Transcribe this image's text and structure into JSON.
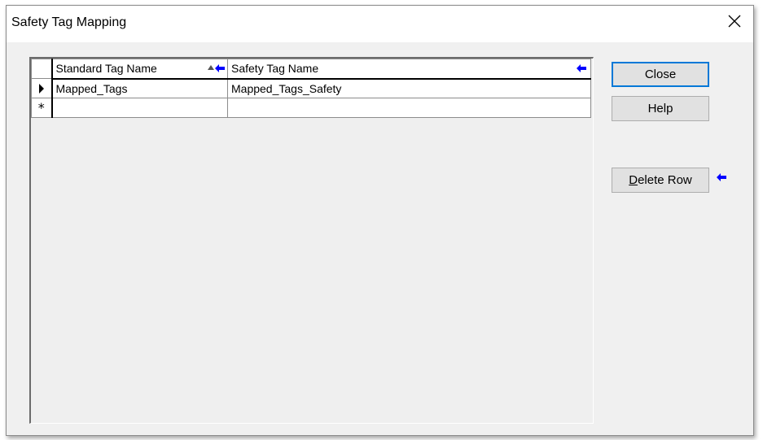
{
  "window": {
    "title": "Safety Tag Mapping",
    "close_icon": "close-icon"
  },
  "grid": {
    "columns": [
      {
        "label": "Standard Tag Name",
        "sorted": "ascending"
      },
      {
        "label": "Safety Tag Name"
      }
    ],
    "rows": [
      {
        "standard": "Mapped_Tags",
        "safety": "Mapped_Tags_Safety",
        "current": true
      }
    ],
    "new_row_marker": "*"
  },
  "buttons": {
    "close": "Close",
    "help": "Help",
    "delete_row_mnemonic": "D",
    "delete_row_rest": "elete Row"
  },
  "colors": {
    "annotation_arrow": "#0000ff",
    "default_button_border": "#0078d7",
    "dialog_bg": "#f0f0f0"
  }
}
